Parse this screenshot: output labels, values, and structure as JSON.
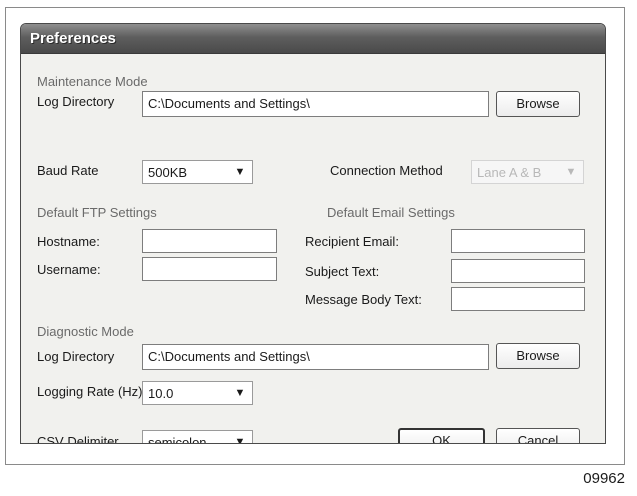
{
  "window": {
    "title": "Preferences"
  },
  "maintenance": {
    "section_label": "Maintenance Mode",
    "log_dir_label": "Log Directory",
    "log_dir_value": "C:\\Documents and Settings\\",
    "browse_label": "Browse"
  },
  "baud": {
    "label": "Baud Rate",
    "value": "500KB"
  },
  "connection": {
    "label": "Connection Method",
    "value": "Lane A & B"
  },
  "ftp": {
    "section_label": "Default FTP Settings",
    "hostname_label": "Hostname:",
    "hostname_value": "",
    "username_label": "Username:",
    "username_value": ""
  },
  "email": {
    "section_label": "Default Email Settings",
    "recipient_label": "Recipient Email:",
    "recipient_value": "",
    "subject_label": "Subject Text:",
    "subject_value": "",
    "body_label": "Message Body Text:",
    "body_value": ""
  },
  "diagnostic": {
    "section_label": "Diagnostic Mode",
    "log_dir_label": "Log Directory",
    "log_dir_value": "C:\\Documents and Settings\\",
    "browse_label": "Browse",
    "logging_rate_label": "Logging Rate (Hz)",
    "logging_rate_value": "10.0"
  },
  "csv": {
    "label": "CSV Delimiter",
    "value": "semicolon"
  },
  "buttons": {
    "ok": "OK",
    "cancel": "Cancel"
  },
  "figure_id": "09962",
  "icons": {
    "dropdown": "chevron-down-icon"
  },
  "colors": {
    "titlebar": "#5e5e5e",
    "dialog_bg": "#f1f1ee"
  }
}
